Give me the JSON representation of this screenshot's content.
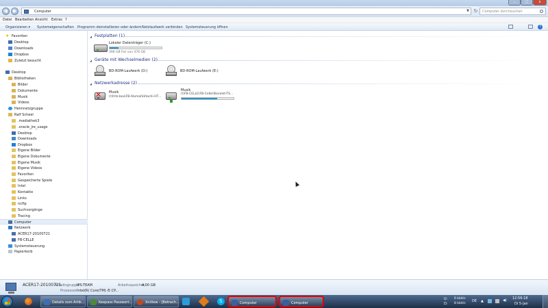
{
  "window": {
    "controls": {
      "minimize": "–",
      "maximize": "□",
      "close": "x"
    }
  },
  "address_bar": {
    "path": "Computer",
    "search_placeholder": "Computer durchsuchen",
    "back_icon": "back-arrow-icon",
    "forward_icon": "forward-arrow-icon"
  },
  "menu": [
    "Datei",
    "Bearbeiten",
    "Ansicht",
    "Extras",
    "?"
  ],
  "commands": [
    "Organisieren ▾",
    "Systemeigenschaften",
    "Programm deinstallieren oder ändern",
    "Netzlaufwerk verbinden",
    "Systemsteuerung öffnen"
  ],
  "nav": {
    "favorites": [
      "Favoriten",
      "Desktop",
      "Downloads",
      "Dropbox",
      "Zuletzt besucht"
    ],
    "tree": [
      "Desktop",
      "Bibliotheken",
      "Bilder",
      "Dokumente",
      "Musik",
      "Videos",
      "Heimnetzgruppe",
      "Ralf Scheel",
      ".mediathek3",
      ".oracle_jre_usage",
      "Desktop",
      "Downloads",
      "Dropbox",
      "Eigene Bilder",
      "Eigene Dokumente",
      "Eigene Musik",
      "Eigene Videos",
      "Favoriten",
      "Gespeicherte Spiele",
      "Intel",
      "Kontakte",
      "Links",
      "ncftp",
      "Suchvorgänge",
      "Tracing",
      "Computer",
      "Netzwerk",
      "ACER17-20100721",
      "FB-CELLE",
      "Systemsteuerung",
      "Papierkorb"
    ]
  },
  "groups": {
    "hdd": {
      "title": "Festplatten (1)"
    },
    "removable": {
      "title": "Geräte mit Wechselmedien (2)"
    },
    "network": {
      "title": "Netzwerkadresse (2)"
    }
  },
  "drives": {
    "c": {
      "label": "Lokaler Datenträger (C:)",
      "free": "396 GB frei von 476 GB",
      "used_fraction": 0.17
    },
    "d": {
      "label": "BD-ROM-Laufwerk (D:)"
    },
    "e": {
      "label": "BD-ROM-Laufwerk (E:)"
    },
    "net1": {
      "label": "Musik",
      "path": "(\\\\fritz.box\\FB-Alomal\\Hitachi-HT..."
    },
    "net2": {
      "label": "Musik",
      "path": "(\\\\FB-CELLE\\FB-Celle\\Storelet-TS...",
      "used_fraction": 0.68
    }
  },
  "details": {
    "name": "ACER17-20100721",
    "workgroup_label": "Arbeitsgruppe:",
    "workgroup": "IPS-TEAM",
    "memory_label": "Arbeitsspeicher:",
    "memory": "4,00 GB",
    "processor_label": "Prozessor:",
    "processor": "Intel(R) Core(TM) i5 CP..."
  },
  "taskbar": {
    "buttons": [
      {
        "label": "Details zum Artik...",
        "color": "#3b6fb3"
      },
      {
        "label": "Keepass Passwort...",
        "color": "#4c8a3c"
      },
      {
        "label": "XnView - [Betrach...",
        "color": "#c04a1c"
      },
      {
        "label": "Computer",
        "color": "#3a5f9f"
      },
      {
        "label": "Computer",
        "color": "#3a5f9f"
      }
    ],
    "tray": {
      "upload": "6 kbit/s",
      "download": "8 kbit/s",
      "lang": "DE",
      "time": "12:56:18",
      "date": "Di 5-Jan"
    }
  },
  "colors": {
    "highlight": "#e60000",
    "group_header": "#1e3287",
    "drive_fill": "#1a7fb5"
  }
}
